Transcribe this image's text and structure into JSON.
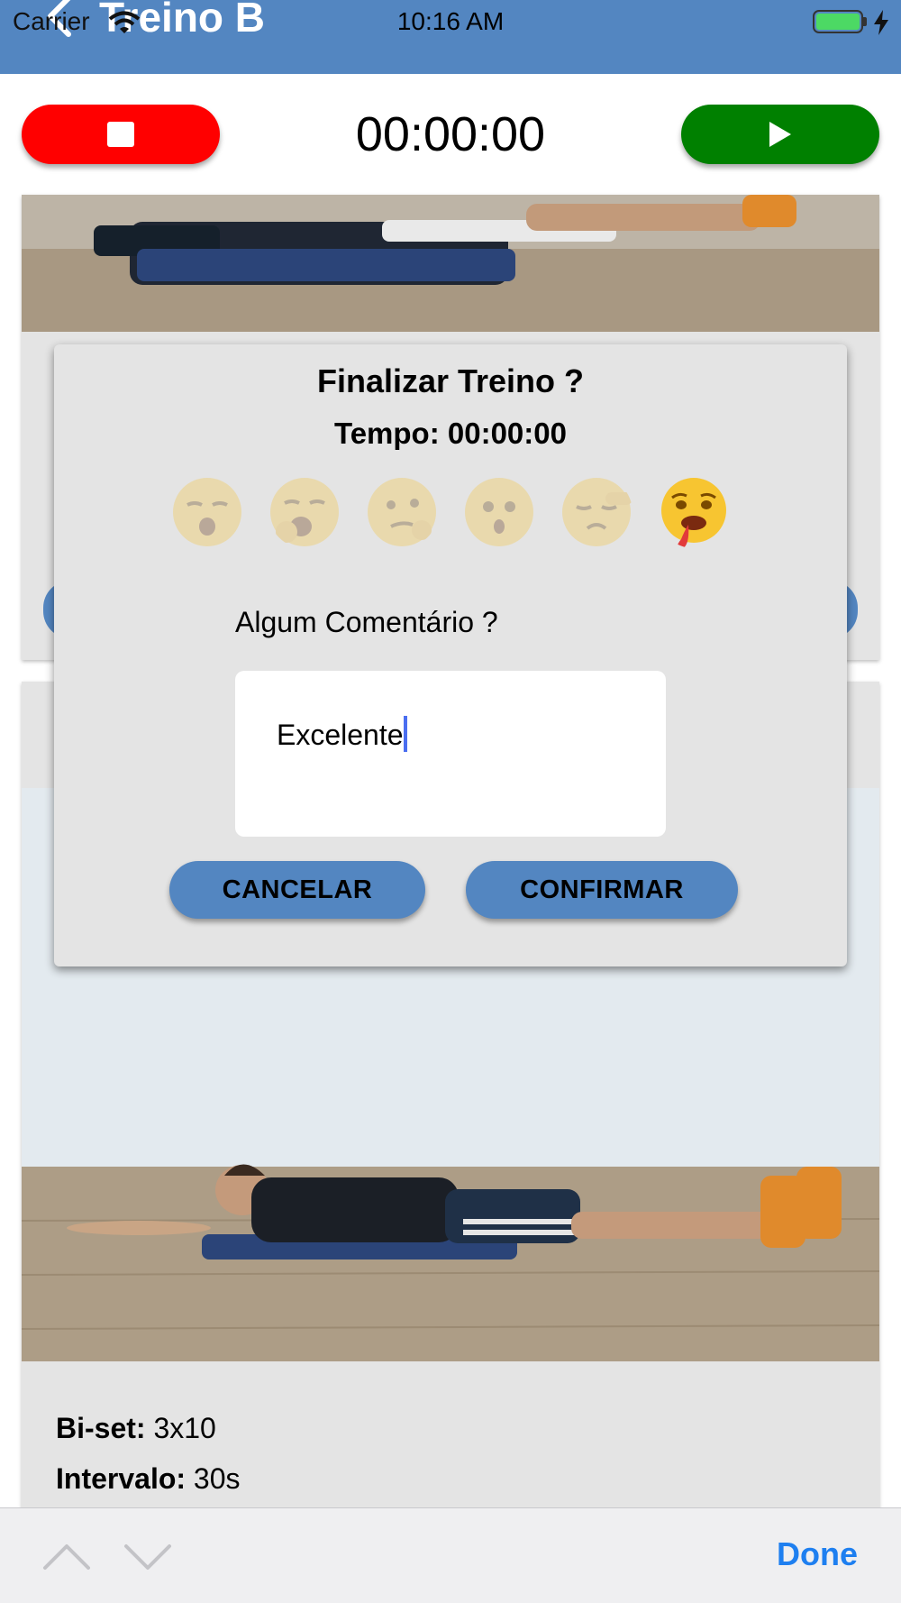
{
  "status_bar": {
    "carrier": "Carrier",
    "time": "10:16 AM",
    "battery_color": "#4cd964"
  },
  "nav": {
    "title": "Treino B",
    "back_icon": "chevron-left-icon",
    "background": "#5386c1"
  },
  "timer": {
    "display": "00:00:00",
    "stop_color": "#ff0000",
    "play_color": "#008000"
  },
  "card_2": {
    "biset_label": "Bi-set:",
    "biset_value": "3x10",
    "interval_label": "Intervalo:",
    "interval_value": "30s"
  },
  "modal": {
    "title": "Finalizar Treino ?",
    "time_text": "Tempo: 00:00:00",
    "moods": [
      {
        "icon": "sleeping-face-icon",
        "selected": false
      },
      {
        "icon": "yawning-face-icon",
        "selected": false
      },
      {
        "icon": "thinking-face-icon",
        "selected": false
      },
      {
        "icon": "surprised-face-icon",
        "selected": false
      },
      {
        "icon": "tired-face-icon",
        "selected": false
      },
      {
        "icon": "exhausted-face-icon",
        "selected": true
      }
    ],
    "comment_label": "Algum Comentário ?",
    "comment_value": "Excelente",
    "cancel_label": "CANCELAR",
    "confirm_label": "CONFIRMAR"
  },
  "accessory_bar": {
    "done_label": "Done",
    "done_color": "#1e7ff0"
  }
}
